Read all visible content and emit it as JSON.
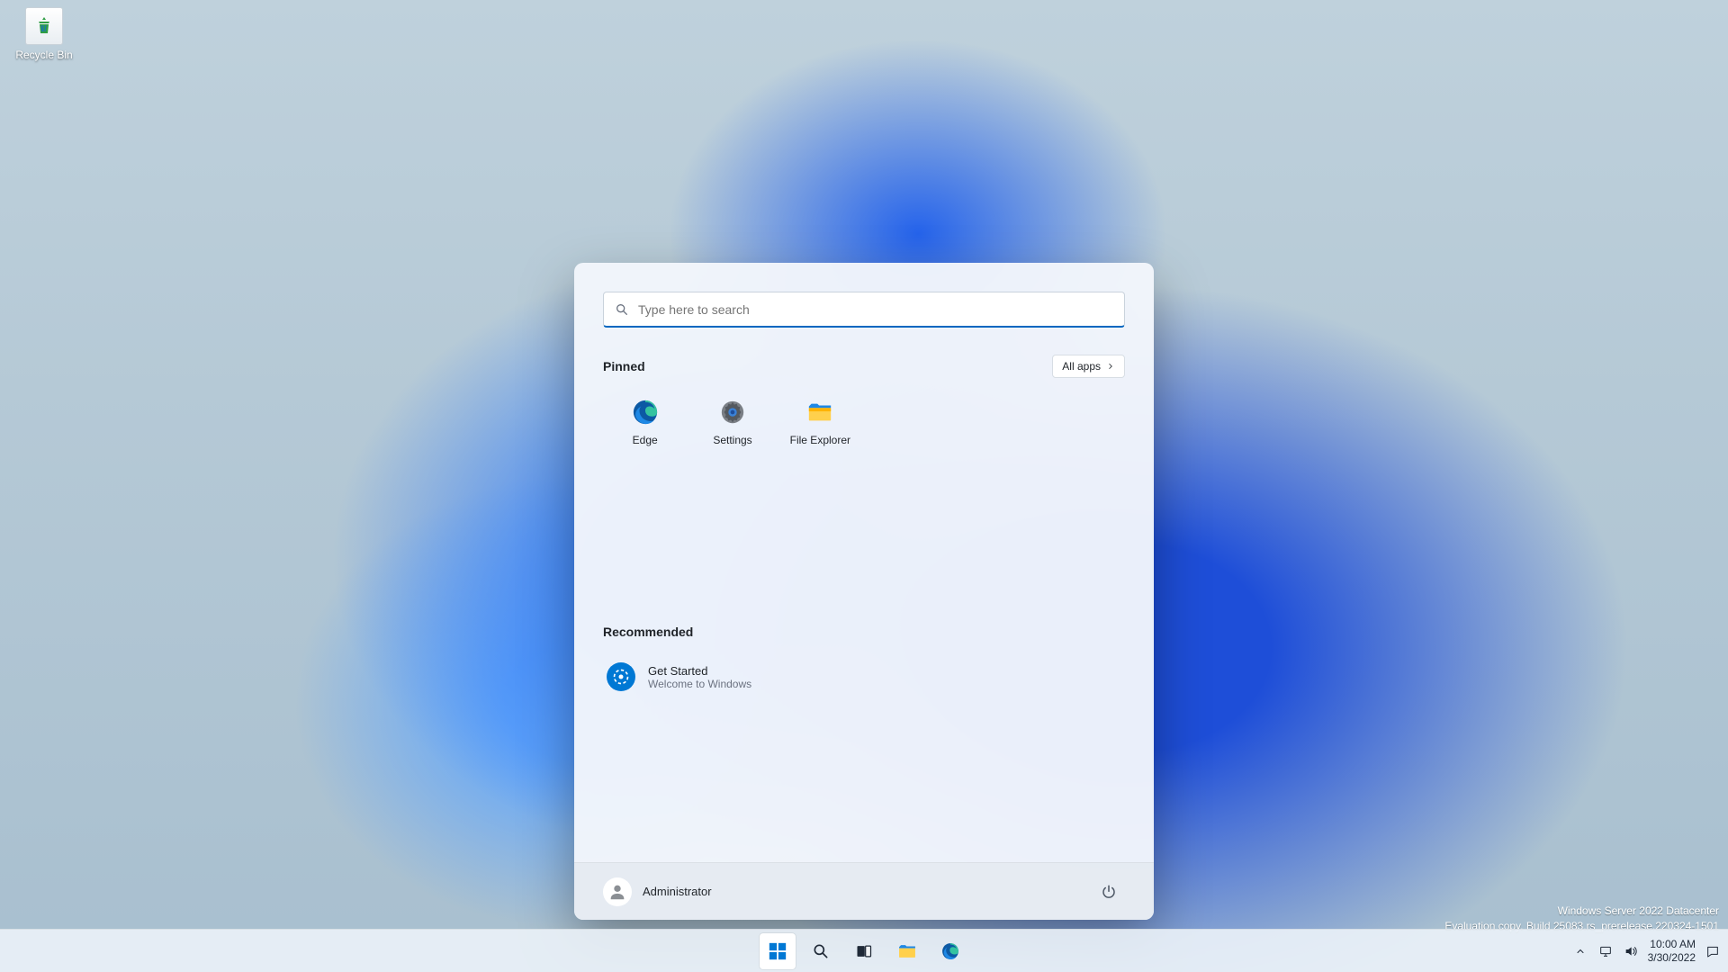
{
  "desktop": {
    "icons": [
      {
        "name": "recycle-bin",
        "label": "Recycle Bin"
      }
    ]
  },
  "watermark": {
    "line1": "Windows Server 2022 Datacenter",
    "line2": "Evaluation copy. Build 25083.rs_prerelease.220324-1501"
  },
  "start": {
    "search_placeholder": "Type here to search",
    "pinned_header": "Pinned",
    "all_apps_label": "All apps",
    "pinned": [
      {
        "name": "edge",
        "label": "Edge"
      },
      {
        "name": "settings",
        "label": "Settings"
      },
      {
        "name": "file-explorer",
        "label": "File Explorer"
      }
    ],
    "recommended_header": "Recommended",
    "recommended": [
      {
        "name": "get-started",
        "title": "Get Started",
        "subtitle": "Welcome to Windows"
      }
    ],
    "user_name": "Administrator"
  },
  "taskbar": {
    "time": "10:00 AM",
    "date": "3/30/2022"
  }
}
